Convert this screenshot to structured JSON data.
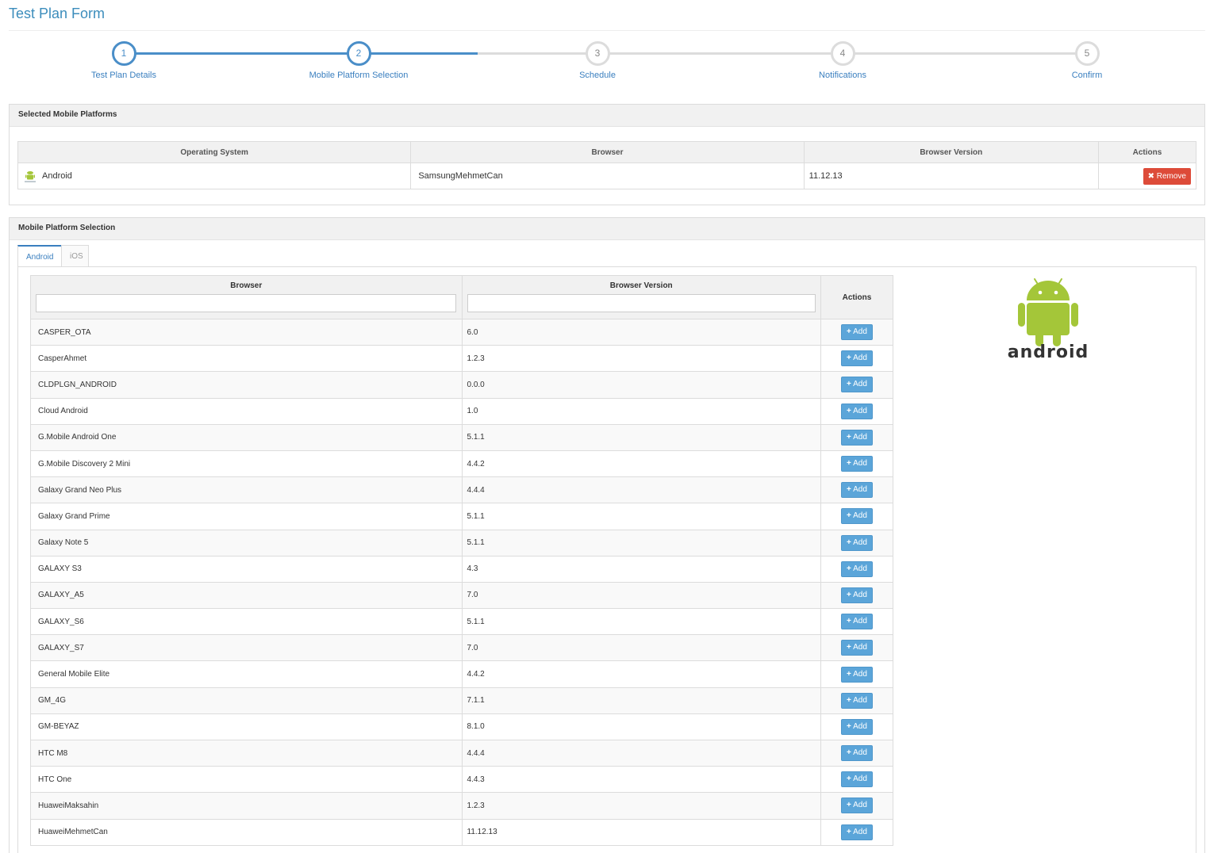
{
  "page": {
    "title": "Test Plan Form"
  },
  "wizard": {
    "steps": [
      {
        "number": "1",
        "label": "Test Plan Details",
        "state": "done"
      },
      {
        "number": "2",
        "label": "Mobile Platform Selection",
        "state": "active"
      },
      {
        "number": "3",
        "label": "Schedule",
        "state": "pending"
      },
      {
        "number": "4",
        "label": "Notifications",
        "state": "pending"
      },
      {
        "number": "5",
        "label": "Confirm",
        "state": "pending"
      }
    ]
  },
  "selected": {
    "heading": "Selected Mobile Platforms",
    "columns": [
      "Operating System",
      "Browser",
      "Browser Version",
      "Actions"
    ],
    "rows": [
      {
        "os": "Android",
        "browser": "SamsungMehmetCan",
        "version": "11.12.13",
        "action": "Remove"
      }
    ]
  },
  "selection": {
    "heading": "Mobile Platform Selection",
    "tabs": [
      "Android",
      "iOS"
    ],
    "active_tab": "Android",
    "columns": [
      "Browser",
      "Browser Version",
      "Actions"
    ],
    "add_label": "Add",
    "logo_text": "android",
    "rows": [
      {
        "browser": "CASPER_OTA",
        "version": "6.0"
      },
      {
        "browser": "CasperAhmet",
        "version": "1.2.3"
      },
      {
        "browser": "CLDPLGN_ANDROID",
        "version": "0.0.0"
      },
      {
        "browser": "Cloud Android",
        "version": "1.0"
      },
      {
        "browser": "G.Mobile Android One",
        "version": "5.1.1"
      },
      {
        "browser": "G.Mobile Discovery 2 Mini",
        "version": "4.4.2"
      },
      {
        "browser": "Galaxy Grand Neo Plus",
        "version": "4.4.4"
      },
      {
        "browser": "Galaxy Grand Prime",
        "version": "5.1.1"
      },
      {
        "browser": "Galaxy Note 5",
        "version": "5.1.1"
      },
      {
        "browser": "GALAXY S3",
        "version": "4.3"
      },
      {
        "browser": "GALAXY_A5",
        "version": "7.0"
      },
      {
        "browser": "GALAXY_S6",
        "version": "5.1.1"
      },
      {
        "browser": "GALAXY_S7",
        "version": "7.0"
      },
      {
        "browser": "General Mobile Elite",
        "version": "4.4.2"
      },
      {
        "browser": "GM_4G",
        "version": "7.1.1"
      },
      {
        "browser": "GM-BEYAZ",
        "version": "8.1.0"
      },
      {
        "browser": "HTC M8",
        "version": "4.4.4"
      },
      {
        "browser": "HTC One",
        "version": "4.4.3"
      },
      {
        "browser": "HuaweiMaksahin",
        "version": "1.2.3"
      },
      {
        "browser": "HuaweiMehmetCan",
        "version": "11.12.13"
      }
    ]
  },
  "colors": {
    "accent": "#3c8dbc",
    "add_button": "#5ba5d9",
    "remove_button": "#dd4b39",
    "android_green": "#a4c639"
  }
}
